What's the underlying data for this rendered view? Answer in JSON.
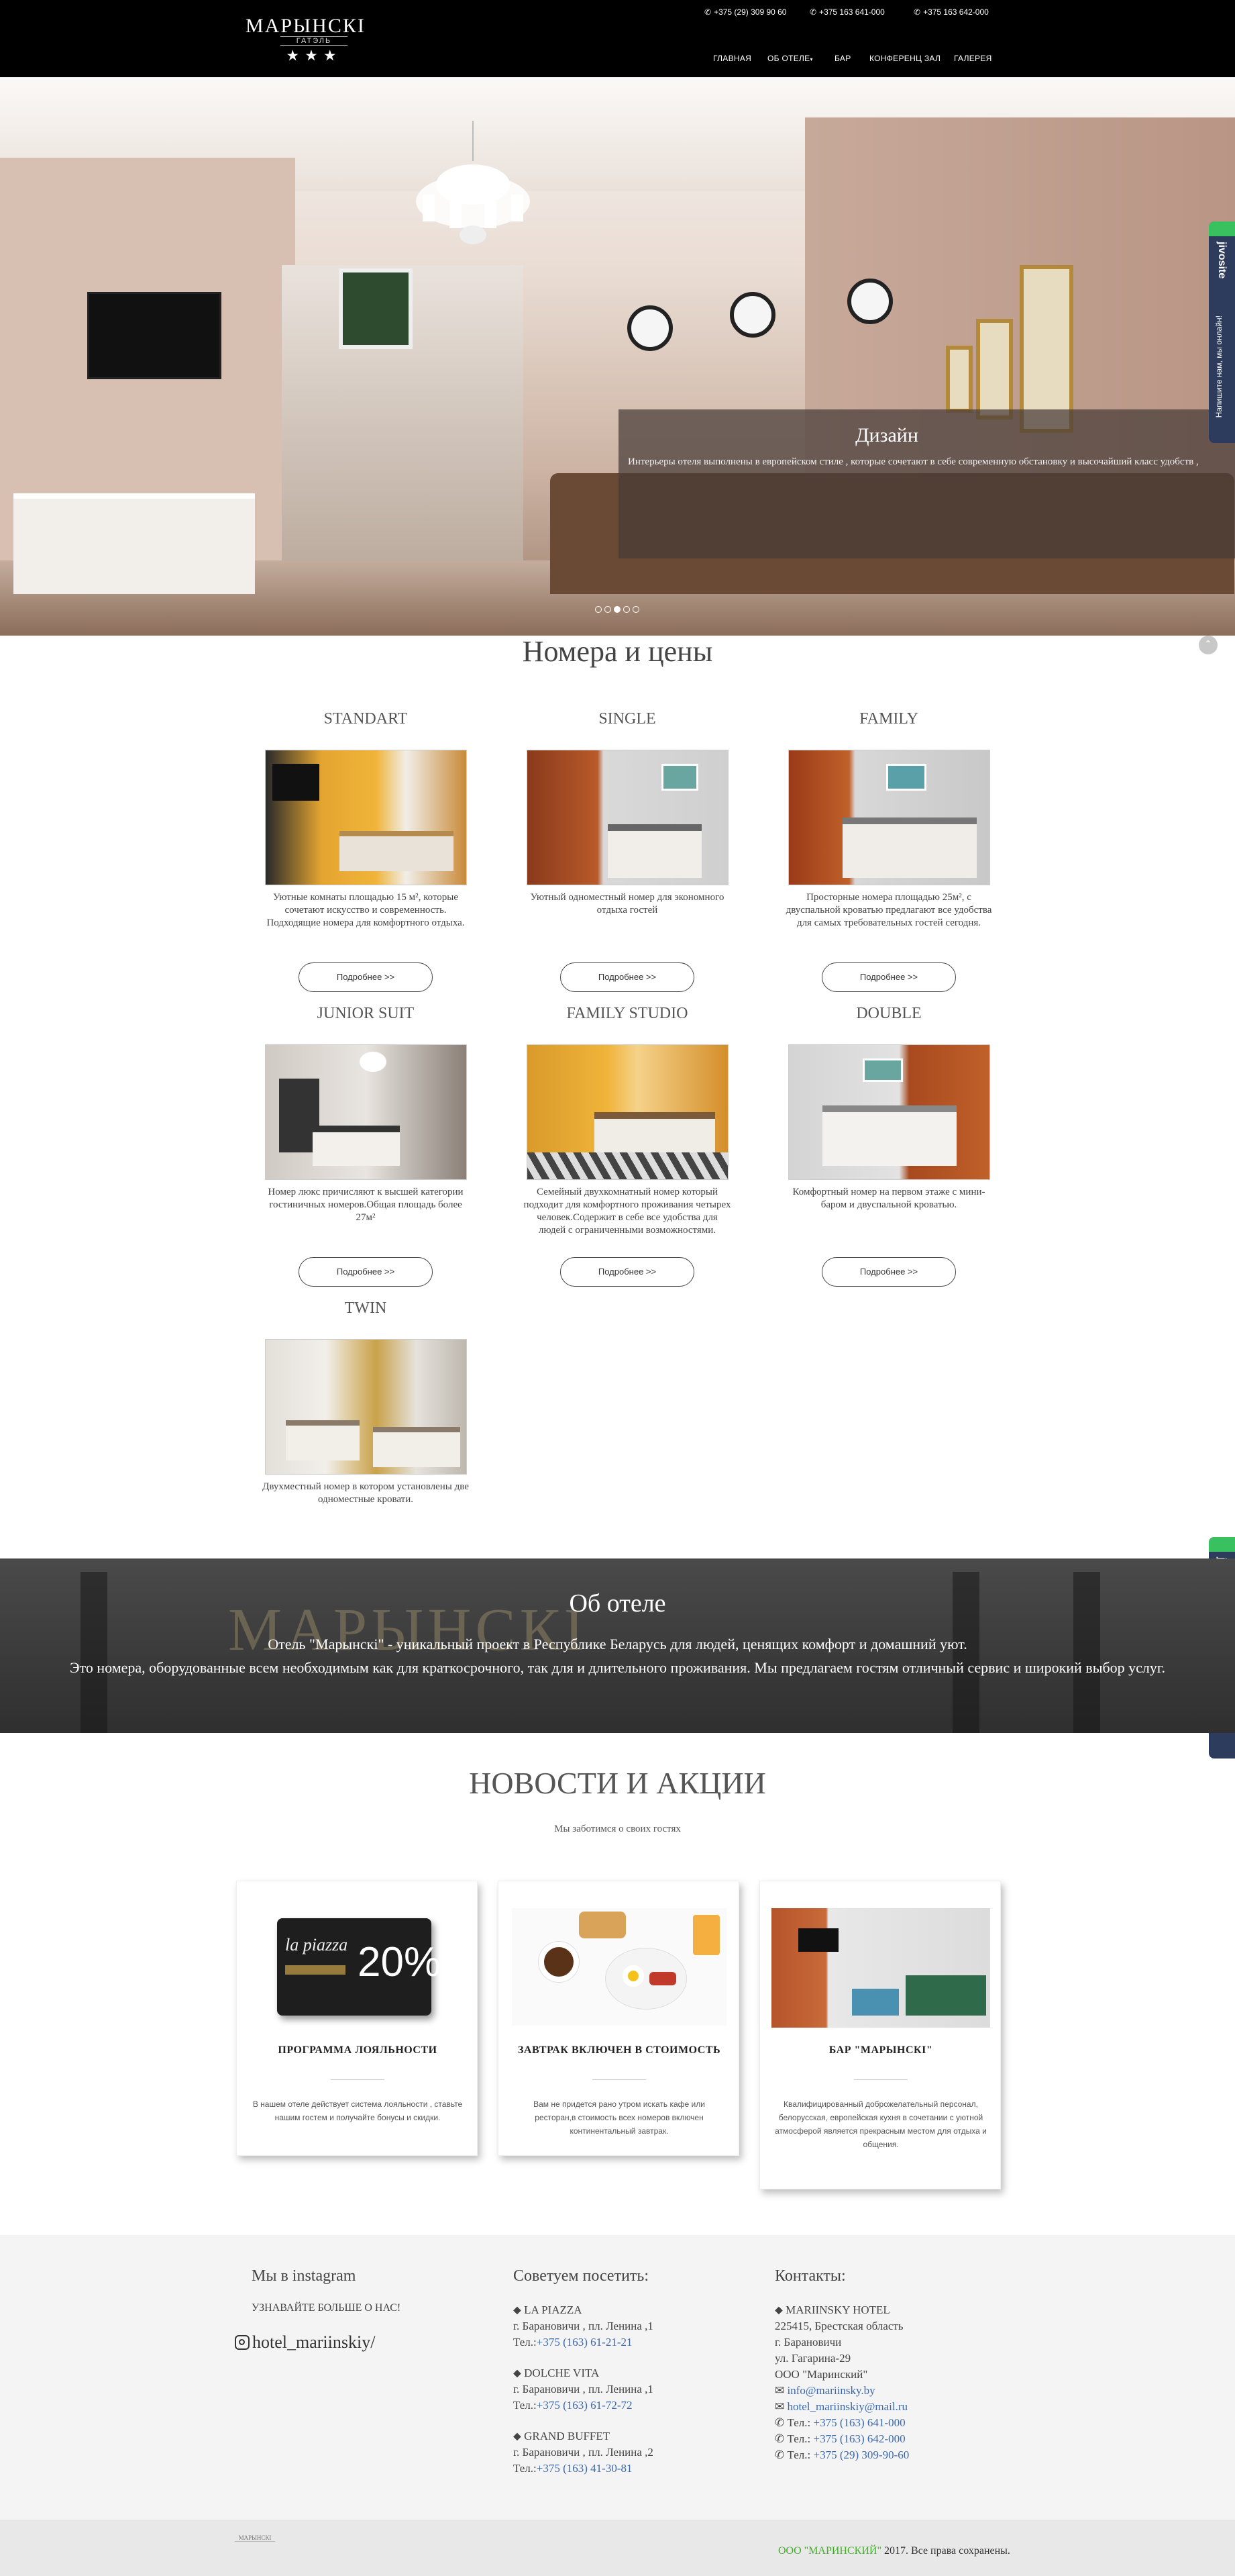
{
  "header": {
    "logo_title": "МАРЫНСКІ",
    "logo_sub": "ГАТЭЛЬ",
    "logo_stars": "★★★",
    "phones": [
      "+375 (29) 309 90 60",
      "+375 163 641-000",
      "+375 163 642-000"
    ],
    "nav": [
      "ГЛАВНАЯ",
      "ОБ ОТЕЛЕ",
      "БАР",
      "КОНФЕРЕНЦ ЗАЛ",
      "ГАЛЕРЕЯ"
    ]
  },
  "hero": {
    "caption_title": "Дизайн",
    "caption_text": "Интерьеры отеля выполнены в европейском стиле , которые сочетают в себе современную обстановку и высочайший класс удобств ,"
  },
  "widget": {
    "logo": "jivosite",
    "text": "Напишите нам, мы онлайн!"
  },
  "rooms": {
    "title": "Номера и цены",
    "button_label": "Подробнее >>",
    "items": [
      {
        "name": "STANDART",
        "desc": "Уютные комнаты площадью 15 м², которые сочетают искусство и современность. Подходящие номера для комфортного отдыха."
      },
      {
        "name": "SINGLE",
        "desc": "Уютный одноместный номер для экономного отдыха гостей"
      },
      {
        "name": "FAMILY",
        "desc": "Просторные номера площадью 25м², с двуспальной кроватью предлагают все удобства для самых требовательных гостей сегодня."
      },
      {
        "name": "JUNIOR SUIT",
        "desc": "Номер люкс причисляют к высшей категории гостиничных номеров.Общая площадь более 27м²"
      },
      {
        "name": "FAMILY STUDIO",
        "desc": "Семейный двухкомнатный номер который подходит для комфортного проживания четырех человек.Содержит в себе все удобства для людей с ограниченными возможностями."
      },
      {
        "name": "DOUBLE",
        "desc": "Комфортный номер на первом этаже с мини-баром и двуспальной кроватью."
      },
      {
        "name": "TWIN",
        "desc": "Двухместный номер в котором установлены две одноместные кровати."
      }
    ]
  },
  "about": {
    "title": "Об отеле",
    "line1": "Отель \"Марынскі\" - уникальный проект в Республике Беларусь для людей, ценящих комфорт и домашний уют.",
    "line2": "Это номера, оборудованные всем необходимым как для краткосрочного, так для и длительного проживания. Мы предлагаем гостям отличный сервис и широкий выбор услуг.",
    "bg_text": "МАРЫНСКІ"
  },
  "news": {
    "title": "НОВОСТИ И АКЦИИ",
    "subtitle": "Мы заботимся о своих гостях",
    "cards": [
      {
        "title": "ПРОГРАММА ЛОЯЛЬНОСТИ",
        "text": "В нашем отеле действует система лояльности , ставьте нашим гостем и получайте бонусы и скидки.",
        "badge": "20%",
        "badge_brand": "la piazza"
      },
      {
        "title": "ЗАВТРАК ВКЛЮЧЕН В СТОИМОСТЬ",
        "text": "Вам не придется рано утром искать кафе или ресторан,в стоимость всех номеров включен континентальный завтрак."
      },
      {
        "title": "БАР \"МАРЫНСКІ\"",
        "text": "Квалифицированный доброжелательный персонал, белорусская, европейская кухня в сочетании с уютной атмосферой является прекрасным местом для отдыха и общения."
      }
    ]
  },
  "footer": {
    "instagram": {
      "head": "Мы в instagram",
      "sub": "УЗНАВАЙТЕ БОЛЬШЕ О НАС!",
      "handle": "hotel_mariinskiy/"
    },
    "recommend": {
      "head": "Советуем посетить:",
      "places": [
        {
          "name": "LA PIAZZA",
          "addr": "г. Барановичи , пл. Ленина ,1",
          "tel_label": "Тел.:",
          "tel": "+375 (163) 61-21-21"
        },
        {
          "name": "DOLCHE VITA",
          "addr": "г. Барановичи , пл. Ленина ,1",
          "tel_label": "Тел.:",
          "tel": "+375 (163) 61-72-72"
        },
        {
          "name": "GRAND BUFFET",
          "addr": "г. Барановичи , пл. Ленина ,2",
          "tel_label": "Тел.:",
          "tel": "+375 (163) 41-30-81"
        }
      ]
    },
    "contacts": {
      "head": "Контакты:",
      "lines": [
        "MARIINSKY HOTEL",
        "225415, Брестская область",
        "г. Барановичи",
        "ул. Гагарина-29",
        "ООО \"Маринский\""
      ],
      "email1": "info@mariinsky.by",
      "email2": "hotel_mariinskiy@mail.ru",
      "tel_label": "Тел.:",
      "phones": [
        "+375 (163) 641-000",
        "+375 (163) 642-000",
        "+375 (29) 309-90-60"
      ]
    }
  },
  "bottom": {
    "logo": "МАРЫНСКІ",
    "company": "ООО \"МАРИНСКИЙ\"",
    "copyright": " 2017. Все права сохранены."
  },
  "colors": {
    "header_bg": "#000000",
    "link": "#3a68b0",
    "company_green": "#43b02a",
    "widget_bg": "#2d3b5d",
    "widget_accent": "#39c15f"
  }
}
